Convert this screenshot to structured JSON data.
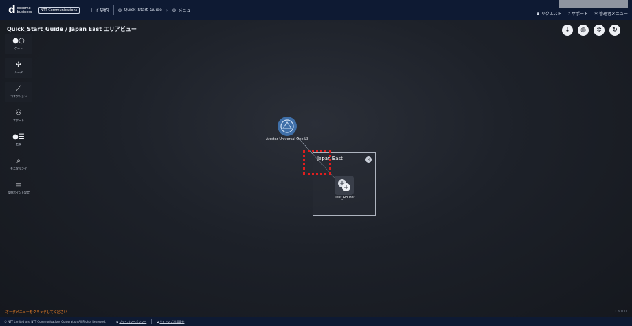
{
  "header": {
    "logo_main": "d",
    "logo_line1": "docomo",
    "logo_line2": "business",
    "ntt_logo_text": "NTT Communications",
    "contract_label": "子契約",
    "project_label": "Quick_Start_Guide",
    "menu_label": "メニュー",
    "request_label": "リクエスト",
    "support_label": "サポート",
    "admin_menu_label": "管理者メニュー"
  },
  "page": {
    "title": "Quick_Start_Guide / Japan East エリアビュー"
  },
  "toolbar": {
    "buttons": [
      {
        "name": "download-icon",
        "glyph": "⤓"
      },
      {
        "name": "globe-icon",
        "glyph": "◍"
      },
      {
        "name": "gear-icon",
        "glyph": "✲"
      },
      {
        "name": "refresh-icon",
        "glyph": "↻"
      }
    ]
  },
  "palette": {
    "items": [
      {
        "label": "ゲート",
        "icon": "gate-icon",
        "glyph": "●○"
      },
      {
        "label": "ルータ",
        "icon": "router-icon",
        "glyph": "✣"
      },
      {
        "label": "コネクション",
        "icon": "connection-icon",
        "glyph": "⟋"
      },
      {
        "label": "サポート",
        "icon": "support-icon",
        "glyph": "⚇"
      },
      {
        "label": "監視",
        "icon": "monitor-list-icon",
        "glyph": "●☰"
      },
      {
        "label": "モニタリング",
        "icon": "monitoring-icon",
        "glyph": "⌕"
      },
      {
        "label": "仮想ポイント設定",
        "icon": "virtual-point-icon",
        "glyph": "▭"
      }
    ]
  },
  "diagram": {
    "cloud_node_label": "Arcstar Universal One L3",
    "area_title": "Japan East",
    "area_close_glyph": "×",
    "router_label": "Test_Router"
  },
  "status": {
    "hint": "オーダメニューをクリックしてください",
    "version": "1.6.0.0"
  },
  "footer": {
    "copyright": "© NTT Limited and NTT Communications Corporation All Rights Reserved.",
    "privacy_link": "プライバシーポリシー",
    "terms_link": "サイトのご利用条件"
  },
  "colors": {
    "header_bg": "#0e1a33",
    "cloud_node": "#3f6fa8",
    "highlight": "#e01e1e",
    "hint": "#ff8a2a"
  }
}
